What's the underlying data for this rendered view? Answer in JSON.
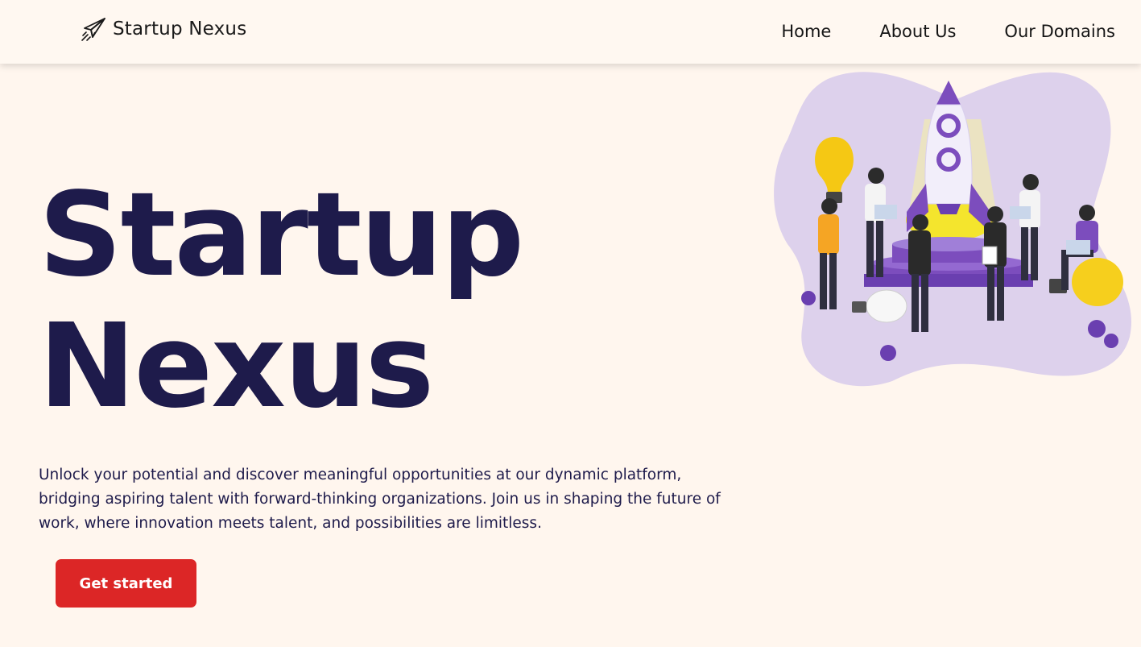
{
  "nav": {
    "brand": "Startup Nexus",
    "links": [
      "Home",
      "About Us",
      "Our Domains"
    ]
  },
  "hero": {
    "title_line1": "Startup",
    "title_line2": "Nexus",
    "description": "Unlock your potential and discover meaningful opportunities at our dynamic platform, bridging aspiring talent with forward-thinking organizations. Join us in shaping the future of work, where innovation meets talent, and possibilities are limitless.",
    "cta_label": "Get started"
  },
  "icons": {
    "logo": "paper-plane-icon",
    "illustration": "rocket-team-illustration"
  },
  "colors": {
    "background": "#fff6ee",
    "title": "#1e1b4b",
    "cta": "#dc2626",
    "accent_purple": "#7c4dbd",
    "blob": "#ddd1ec"
  }
}
